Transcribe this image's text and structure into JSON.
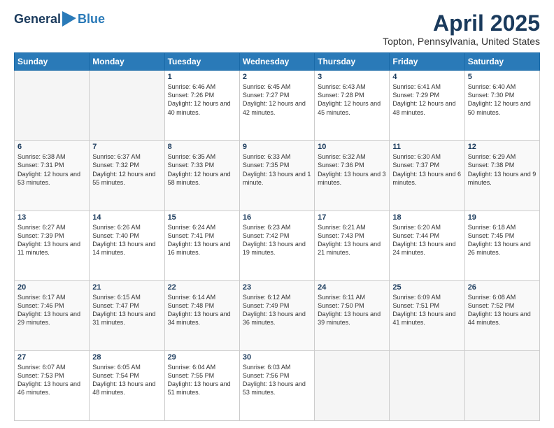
{
  "header": {
    "logo_general": "General",
    "logo_blue": "Blue",
    "month_title": "April 2025",
    "location": "Topton, Pennsylvania, United States"
  },
  "days_of_week": [
    "Sunday",
    "Monday",
    "Tuesday",
    "Wednesday",
    "Thursday",
    "Friday",
    "Saturday"
  ],
  "weeks": [
    [
      {
        "day": "",
        "info": ""
      },
      {
        "day": "",
        "info": ""
      },
      {
        "day": "1",
        "info": "Sunrise: 6:46 AM\nSunset: 7:26 PM\nDaylight: 12 hours and 40 minutes."
      },
      {
        "day": "2",
        "info": "Sunrise: 6:45 AM\nSunset: 7:27 PM\nDaylight: 12 hours and 42 minutes."
      },
      {
        "day": "3",
        "info": "Sunrise: 6:43 AM\nSunset: 7:28 PM\nDaylight: 12 hours and 45 minutes."
      },
      {
        "day": "4",
        "info": "Sunrise: 6:41 AM\nSunset: 7:29 PM\nDaylight: 12 hours and 48 minutes."
      },
      {
        "day": "5",
        "info": "Sunrise: 6:40 AM\nSunset: 7:30 PM\nDaylight: 12 hours and 50 minutes."
      }
    ],
    [
      {
        "day": "6",
        "info": "Sunrise: 6:38 AM\nSunset: 7:31 PM\nDaylight: 12 hours and 53 minutes."
      },
      {
        "day": "7",
        "info": "Sunrise: 6:37 AM\nSunset: 7:32 PM\nDaylight: 12 hours and 55 minutes."
      },
      {
        "day": "8",
        "info": "Sunrise: 6:35 AM\nSunset: 7:33 PM\nDaylight: 12 hours and 58 minutes."
      },
      {
        "day": "9",
        "info": "Sunrise: 6:33 AM\nSunset: 7:35 PM\nDaylight: 13 hours and 1 minute."
      },
      {
        "day": "10",
        "info": "Sunrise: 6:32 AM\nSunset: 7:36 PM\nDaylight: 13 hours and 3 minutes."
      },
      {
        "day": "11",
        "info": "Sunrise: 6:30 AM\nSunset: 7:37 PM\nDaylight: 13 hours and 6 minutes."
      },
      {
        "day": "12",
        "info": "Sunrise: 6:29 AM\nSunset: 7:38 PM\nDaylight: 13 hours and 9 minutes."
      }
    ],
    [
      {
        "day": "13",
        "info": "Sunrise: 6:27 AM\nSunset: 7:39 PM\nDaylight: 13 hours and 11 minutes."
      },
      {
        "day": "14",
        "info": "Sunrise: 6:26 AM\nSunset: 7:40 PM\nDaylight: 13 hours and 14 minutes."
      },
      {
        "day": "15",
        "info": "Sunrise: 6:24 AM\nSunset: 7:41 PM\nDaylight: 13 hours and 16 minutes."
      },
      {
        "day": "16",
        "info": "Sunrise: 6:23 AM\nSunset: 7:42 PM\nDaylight: 13 hours and 19 minutes."
      },
      {
        "day": "17",
        "info": "Sunrise: 6:21 AM\nSunset: 7:43 PM\nDaylight: 13 hours and 21 minutes."
      },
      {
        "day": "18",
        "info": "Sunrise: 6:20 AM\nSunset: 7:44 PM\nDaylight: 13 hours and 24 minutes."
      },
      {
        "day": "19",
        "info": "Sunrise: 6:18 AM\nSunset: 7:45 PM\nDaylight: 13 hours and 26 minutes."
      }
    ],
    [
      {
        "day": "20",
        "info": "Sunrise: 6:17 AM\nSunset: 7:46 PM\nDaylight: 13 hours and 29 minutes."
      },
      {
        "day": "21",
        "info": "Sunrise: 6:15 AM\nSunset: 7:47 PM\nDaylight: 13 hours and 31 minutes."
      },
      {
        "day": "22",
        "info": "Sunrise: 6:14 AM\nSunset: 7:48 PM\nDaylight: 13 hours and 34 minutes."
      },
      {
        "day": "23",
        "info": "Sunrise: 6:12 AM\nSunset: 7:49 PM\nDaylight: 13 hours and 36 minutes."
      },
      {
        "day": "24",
        "info": "Sunrise: 6:11 AM\nSunset: 7:50 PM\nDaylight: 13 hours and 39 minutes."
      },
      {
        "day": "25",
        "info": "Sunrise: 6:09 AM\nSunset: 7:51 PM\nDaylight: 13 hours and 41 minutes."
      },
      {
        "day": "26",
        "info": "Sunrise: 6:08 AM\nSunset: 7:52 PM\nDaylight: 13 hours and 44 minutes."
      }
    ],
    [
      {
        "day": "27",
        "info": "Sunrise: 6:07 AM\nSunset: 7:53 PM\nDaylight: 13 hours and 46 minutes."
      },
      {
        "day": "28",
        "info": "Sunrise: 6:05 AM\nSunset: 7:54 PM\nDaylight: 13 hours and 48 minutes."
      },
      {
        "day": "29",
        "info": "Sunrise: 6:04 AM\nSunset: 7:55 PM\nDaylight: 13 hours and 51 minutes."
      },
      {
        "day": "30",
        "info": "Sunrise: 6:03 AM\nSunset: 7:56 PM\nDaylight: 13 hours and 53 minutes."
      },
      {
        "day": "",
        "info": ""
      },
      {
        "day": "",
        "info": ""
      },
      {
        "day": "",
        "info": ""
      }
    ]
  ]
}
